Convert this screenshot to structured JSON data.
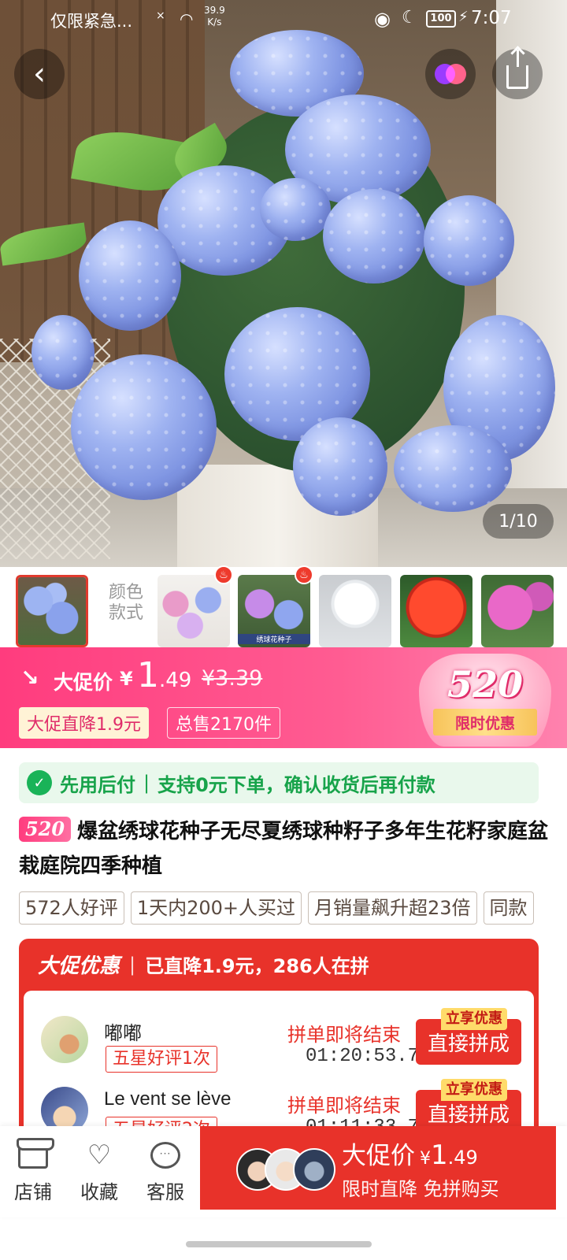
{
  "status_bar": {
    "notification": "仅限紧急...",
    "signal": "×",
    "net_speed_value": "39.9",
    "net_speed_unit": "K/s",
    "battery": "100",
    "time": "7:07"
  },
  "gallery": {
    "counter": "1/10",
    "color_label_line1": "颜色",
    "color_label_line2": "款式",
    "thumb3_caption": "绣球花种子"
  },
  "promo": {
    "label": "大促价",
    "currency": "¥",
    "price_int": "1",
    "price_dec": ".49",
    "original_price": "¥3.39",
    "drop_tag": "大促直降1.9元",
    "sales_tag": "总售2170件",
    "badge_number": "520",
    "badge_text": "限时优惠"
  },
  "pay_later": {
    "title": "先用后付",
    "desc": "支持0元下单，确认收货后再付款"
  },
  "product": {
    "badge": "520",
    "title": "爆盆绣球花种子无尽夏绣球种籽子多年生花籽家庭盆栽庭院四季种植",
    "chips": [
      "572人好评",
      "1天内200+人买过",
      "月销量飙升超23倍",
      "同款"
    ]
  },
  "group_buy": {
    "title": "大促优惠",
    "subtitle": "已直降1.9元，286人在拼",
    "rows": [
      {
        "name": "嘟嘟",
        "badge": "五星好评1次",
        "status": "拼单即将结束",
        "timer": "01:20:53.7",
        "button": "直接拼成",
        "tag": "立享优惠"
      },
      {
        "name": "Le vent se lève",
        "badge": "五星好评2次",
        "status": "拼单即将结束",
        "timer": "01:11:33.7",
        "button": "直接拼成",
        "tag": "立享优惠"
      }
    ]
  },
  "bottom_bar": {
    "store": "店铺",
    "favorite": "收藏",
    "service": "客服",
    "buy_label": "大促价",
    "buy_currency": "¥",
    "buy_int": "1",
    "buy_dec": ".49",
    "buy_sub": "限时直降 免拼购买"
  },
  "colors": {
    "promo_pink": "#ff3c7e",
    "brand_red": "#e8322a",
    "paylater_green": "#17a34a"
  },
  "icons": {
    "back": "chevron-left-icon",
    "twin": "twin-circles-icon",
    "share": "share-icon",
    "store": "store-icon",
    "favorite": "heart-icon",
    "service": "chat-icon"
  }
}
